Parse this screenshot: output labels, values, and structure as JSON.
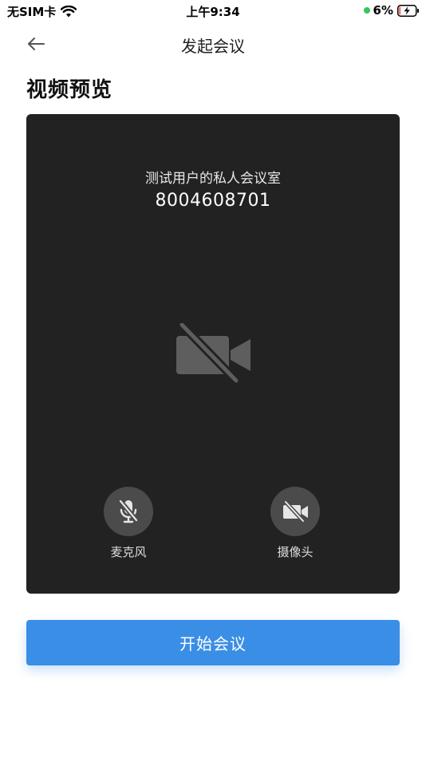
{
  "status_bar": {
    "carrier": "无SIM卡",
    "time": "上午9:34",
    "battery_percent": "6%",
    "battery_level": 0.06,
    "icons": {
      "wifi": "wifi-icon",
      "battery": "battery-charging-icon",
      "dot": "green-indicator-dot"
    },
    "colors": {
      "indicator": "#34c759"
    }
  },
  "nav": {
    "back_icon": "arrow-left-icon",
    "title": "发起会议"
  },
  "heading": "视频预览",
  "preview": {
    "room_name": "测试用户的私人会议室",
    "room_id": "8004608701",
    "placeholder_icon": "camera-off-icon",
    "background": "#222222",
    "controls": {
      "mic": {
        "label": "麦克风",
        "icon": "mic-off-icon",
        "enabled": false
      },
      "camera": {
        "label": "摄像头",
        "icon": "camera-off-icon",
        "enabled": false
      }
    }
  },
  "start_button": {
    "label": "开始会议",
    "color": "#3a8ee6"
  }
}
